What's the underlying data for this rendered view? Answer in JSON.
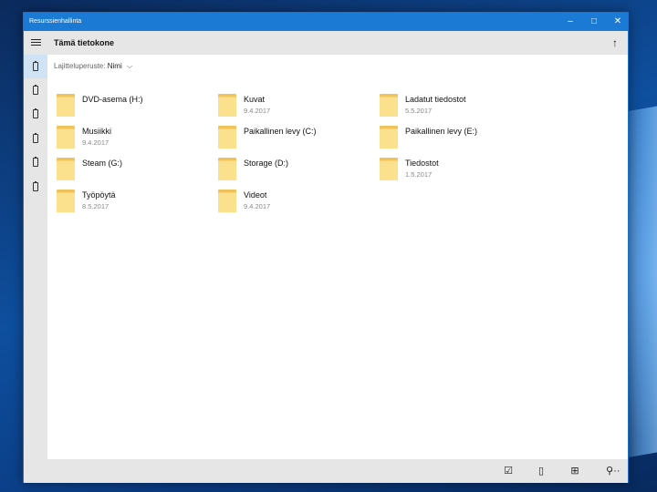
{
  "window": {
    "title": "Resurssienhallinta",
    "minimize_glyph": "–",
    "maximize_glyph": "□",
    "close_glyph": "✕"
  },
  "header": {
    "location_title": "Tämä tietokone",
    "up_glyph": "↑"
  },
  "sort": {
    "label": "Lajitteluperuste:",
    "value": "Nimi",
    "chevron": "⌵"
  },
  "items": [
    {
      "name": "DVD-asema (H:)",
      "date": ""
    },
    {
      "name": "Kuvat",
      "date": "9.4.2017"
    },
    {
      "name": "Ladatut tiedostot",
      "date": "5.5.2017"
    },
    {
      "name": "Musiikki",
      "date": "9.4.2017"
    },
    {
      "name": "Paikallinen levy (C:)",
      "date": ""
    },
    {
      "name": "Paikallinen levy (E:)",
      "date": ""
    },
    {
      "name": "Steam (G:)",
      "date": ""
    },
    {
      "name": "Storage (D:)",
      "date": ""
    },
    {
      "name": "Tiedostot",
      "date": "1.5.2017"
    },
    {
      "name": "Työpöytä",
      "date": "8.5.2017"
    },
    {
      "name": "Videot",
      "date": "9.4.2017"
    }
  ],
  "bottombar": {
    "select_glyph": "☑",
    "device_glyph": "▯",
    "grid_glyph": "⊞",
    "search_glyph": "⚲",
    "more_glyph": "···"
  },
  "colors": {
    "titlebar": "#1a7ad4",
    "folder": "#fbe08d",
    "active_side": "#cfe3f5"
  }
}
